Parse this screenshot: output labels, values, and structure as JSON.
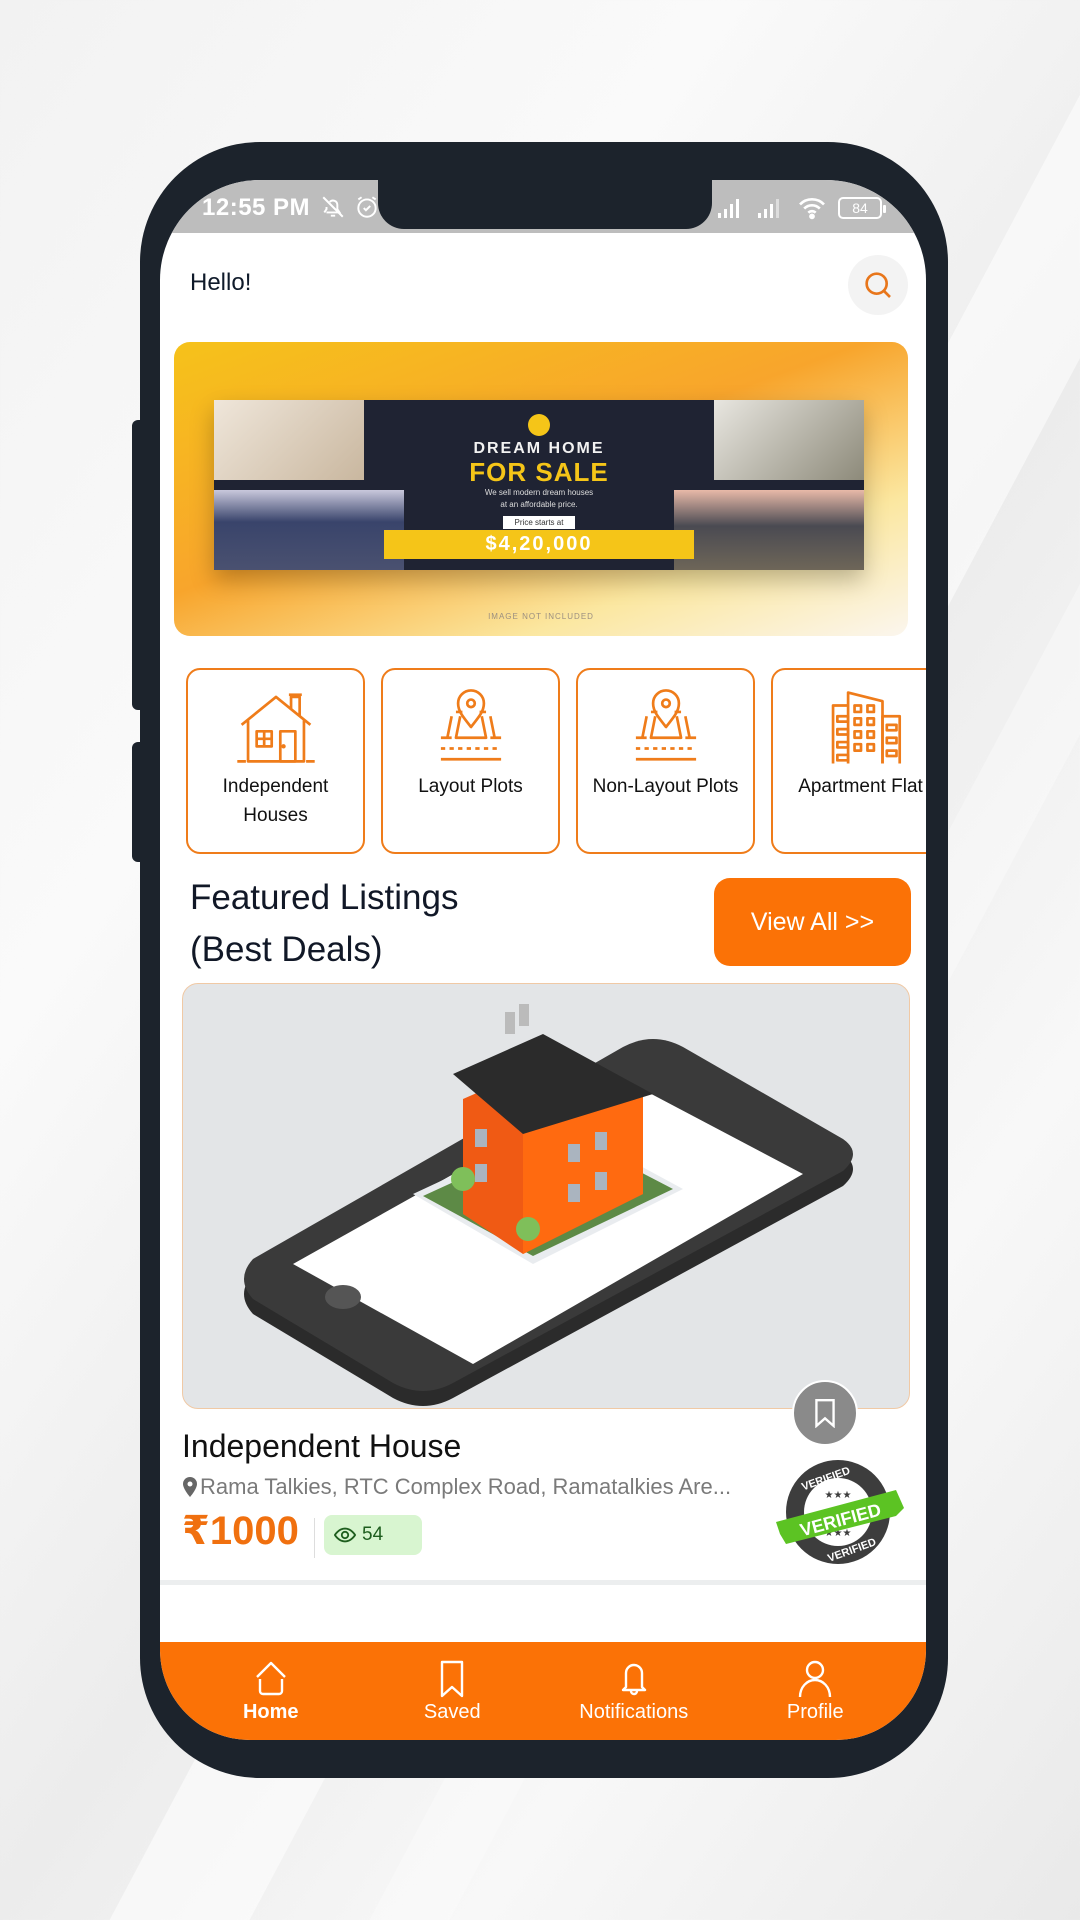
{
  "status_bar": {
    "time": "12:55 PM",
    "battery": "84",
    "icons_left": [
      "bell-off-icon",
      "alarm-icon"
    ],
    "icons_right": [
      "signal-icon",
      "signal-icon",
      "wifi-icon",
      "battery-icon"
    ]
  },
  "header": {
    "greeting": "Hello!",
    "search_icon": "search-icon"
  },
  "banner": {
    "brand": "DREAM HOME",
    "title_line1": "DREAM HOME",
    "title_line2": "FOR SALE",
    "subtitle_line1": "We sell modern dream houses",
    "subtitle_line2": "at an affordable price.",
    "price_label": "Price starts at",
    "price": "$4,20,000",
    "footnote": "IMAGE NOT INCLUDED"
  },
  "categories": [
    {
      "label": "Independent Houses",
      "icon": "house-icon"
    },
    {
      "label": "Layout Plots",
      "icon": "plot-location-icon"
    },
    {
      "label": "Non-Layout Plots",
      "icon": "plot-location-icon"
    },
    {
      "label": "Apartment Flat",
      "icon": "building-icon"
    }
  ],
  "featured": {
    "title_line1": "Featured Listings",
    "title_line2": "(Best Deals)",
    "view_all": "View All >>"
  },
  "listing": {
    "title": "Independent House",
    "address": "Rama Talkies, RTC Complex Road, Ramatalkies Are...",
    "price": "₹1000",
    "views": "54",
    "verified_label": "VERIFIED"
  },
  "bottom_nav": {
    "active": "Home",
    "items": [
      {
        "label": "Home",
        "icon": "home-icon"
      },
      {
        "label": "Saved",
        "icon": "bookmark-icon"
      },
      {
        "label": "Notifications",
        "icon": "bell-icon"
      },
      {
        "label": "Profile",
        "icon": "user-icon"
      }
    ]
  },
  "colors": {
    "accent": "#fb7206",
    "category_border": "#ef7c1a",
    "frame": "#1c232c",
    "views_badge_bg": "#d8f5d0"
  }
}
